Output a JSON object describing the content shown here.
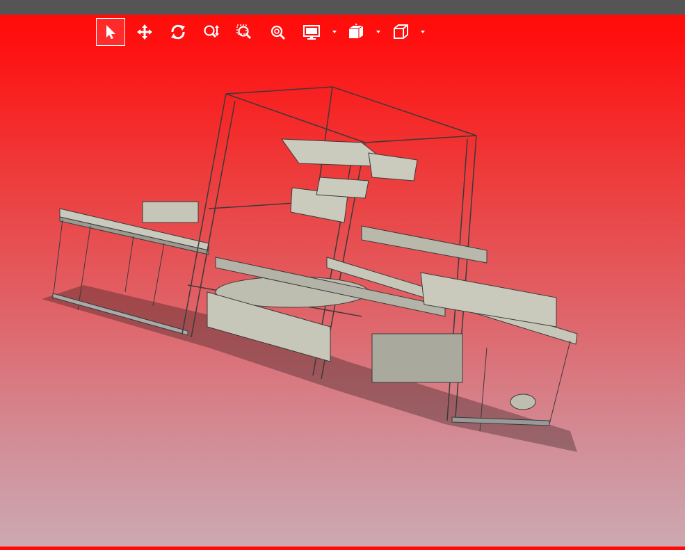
{
  "window": {
    "title_bar_color": "#555555"
  },
  "viewport": {
    "background_gradient": [
      "#ff0a06",
      "#ee3b3b",
      "#dd6a70",
      "#cca9b2"
    ],
    "model": "roller-conveyor-machine-cad-model"
  },
  "toolbar": {
    "tools": [
      {
        "id": "select",
        "icon": "arrow-cursor-icon",
        "active": true
      },
      {
        "id": "pan",
        "icon": "move-arrows-icon",
        "active": false
      },
      {
        "id": "rotate",
        "icon": "rotate-icon",
        "active": false
      },
      {
        "id": "zoom",
        "icon": "zoom-updown-icon",
        "active": false
      },
      {
        "id": "zoom-area",
        "icon": "zoom-area-icon",
        "active": false
      },
      {
        "id": "zoom-fit",
        "icon": "zoom-fit-icon",
        "active": false
      },
      {
        "id": "display",
        "icon": "monitor-icon",
        "active": false,
        "dropdown": true
      },
      {
        "id": "section",
        "icon": "section-view-icon",
        "active": false,
        "dropdown": true
      },
      {
        "id": "view-orientation",
        "icon": "cube-icon",
        "active": false,
        "dropdown": true
      }
    ]
  }
}
